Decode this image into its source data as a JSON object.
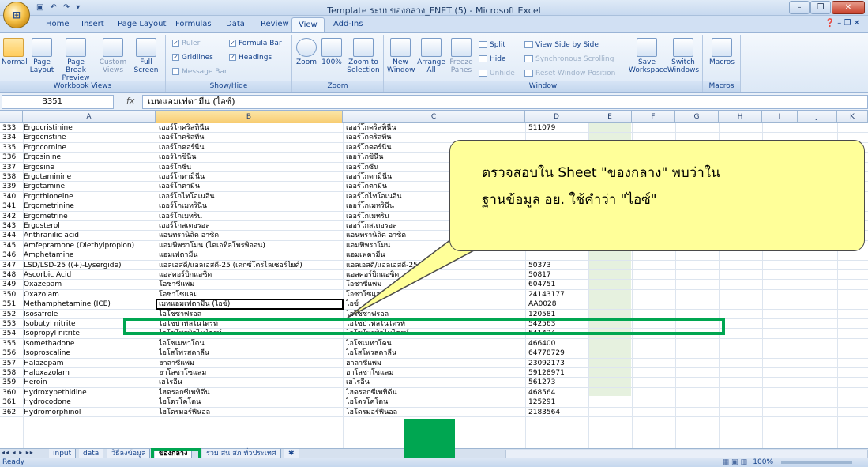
{
  "window": {
    "title": "Template ระบบของกลาง_FNET (5) - Microsoft Excel",
    "qat_icons": [
      "save-icon",
      "undo-icon",
      "redo-icon"
    ],
    "controls": [
      "minimize-icon",
      "restore-icon",
      "close-icon"
    ]
  },
  "ribbon_tabs": [
    "Home",
    "Insert",
    "Page Layout",
    "Formulas",
    "Data",
    "Review",
    "View",
    "Add-Ins"
  ],
  "active_tab": "View",
  "ribbon": {
    "workbook_views": {
      "label": "Workbook Views",
      "normal": "Normal",
      "page_layout": "Page Layout",
      "page_break_preview": "Page Break Preview",
      "custom_views": "Custom Views",
      "full_screen": "Full Screen"
    },
    "show_hide": {
      "label": "Show/Hide",
      "ruler": "Ruler",
      "formula_bar": "Formula Bar",
      "gridlines": "Gridlines",
      "headings": "Headings",
      "message_bar": "Message Bar"
    },
    "zoom": {
      "label": "Zoom",
      "zoom": "Zoom",
      "hundred": "100%",
      "zoom_to_selection": "Zoom to Selection"
    },
    "window": {
      "label": "Window",
      "new_window": "New Window",
      "arrange_all": "Arrange All",
      "freeze_panes": "Freeze Panes",
      "split": "Split",
      "hide": "Hide",
      "unhide": "Unhide",
      "view_side_by_side": "View Side by Side",
      "synchronous_scrolling": "Synchronous Scrolling",
      "reset_window_position": "Reset Window Position",
      "save_workspace": "Save Workspace",
      "switch_windows": "Switch Windows"
    },
    "macros": {
      "label": "Macros",
      "macros": "Macros"
    }
  },
  "formula_bar": {
    "name_box": "B351",
    "fx": "fx",
    "value": "เมทแอมเฟตามีน (ไอซ์)"
  },
  "columns": [
    "A",
    "B",
    "C",
    "D",
    "E",
    "F",
    "G",
    "H",
    "I",
    "J",
    "K"
  ],
  "rows": [
    {
      "n": "333",
      "a": "Ergocristinine",
      "b": "เออร์โกคริสทินีน",
      "c": "เออร์โกคริสทินีน",
      "d": "511079"
    },
    {
      "n": "334",
      "a": "Ergocristine",
      "b": "เออร์โกคริสทีน",
      "c": "เออร์โกคริสทีน",
      "d": ""
    },
    {
      "n": "335",
      "a": "Ergocornine",
      "b": "เออร์โกคอร์นีน",
      "c": "เออร์โกคอร์นีน",
      "d": ""
    },
    {
      "n": "336",
      "a": "Ergosinine",
      "b": "เออร์โกซินีน",
      "c": "เออร์โกซินีน",
      "d": ""
    },
    {
      "n": "337",
      "a": "Ergosine",
      "b": "เออร์โกซีน",
      "c": "เออร์โกซีน",
      "d": ""
    },
    {
      "n": "338",
      "a": "Ergotaminine",
      "b": "เออร์โกตามินีน",
      "c": "เออร์โกตามินีน",
      "d": ""
    },
    {
      "n": "339",
      "a": "Ergotamine",
      "b": "เออร์โกตามีน",
      "c": "เออร์โกตามีน",
      "d": ""
    },
    {
      "n": "340",
      "a": "Ergothioneine",
      "b": "เออร์โกไทโอเนอีน",
      "c": "เออร์โกไทโอเนอีน",
      "d": ""
    },
    {
      "n": "341",
      "a": "Ergometrinine",
      "b": "เออร์โกเมทรินีน",
      "c": "เออร์โกเมทรินีน",
      "d": ""
    },
    {
      "n": "342",
      "a": "Ergometrine",
      "b": "เออร์โกเมทริน",
      "c": "เออร์โกเมทริน",
      "d": ""
    },
    {
      "n": "343",
      "a": "Ergosterol",
      "b": "เออร์โกสเตอรอล",
      "c": "เออร์โกสเตอรอล",
      "d": ""
    },
    {
      "n": "344",
      "a": "Anthranilic acid",
      "b": "แอนทรานิลิค อาซิด",
      "c": "แอนทรานิลิค อาซิด",
      "d": ""
    },
    {
      "n": "345",
      "a": "Amfepramone (Diethylpropion)",
      "b": "แอมฟีพราโมน (ไดเอทิลโพรพิออน)",
      "c": "แอมฟีพราโมน",
      "d": ""
    },
    {
      "n": "346",
      "a": "Amphetamine",
      "b": "แอมเฟตามีน",
      "c": "แอมเฟตามีน",
      "d": ""
    },
    {
      "n": "347",
      "a": "LSD/LSD-25 ((+)-Lysergide)",
      "b": "แอลเอสดี/แอลเอสดี-25 (เดกซ์โตรไลเซอร์ไยด์)",
      "c": "แอลเอสดี/แอลเอสดี-25",
      "d": "50373"
    },
    {
      "n": "348",
      "a": "Ascorbic Acid",
      "b": "แอสคอร์บิกแอซิด",
      "c": "แอสคอร์บิกแอซิด",
      "d": "50817"
    },
    {
      "n": "349",
      "a": "Oxazepam",
      "b": "โอซาซีแพม",
      "c": "โอซาซีแพม",
      "d": "604751"
    },
    {
      "n": "350",
      "a": "Oxazolam",
      "b": "โอซาโซแลม",
      "c": "โอซาโซแลม",
      "d": "24143177"
    },
    {
      "n": "351",
      "a": "Methamphetamine (ICE)",
      "b": "เมทแอมเฟตามีน (ไอซ์)",
      "c": "ไอซ์",
      "d": "AA0028"
    },
    {
      "n": "352",
      "a": "Isosafrole",
      "b": "ไอโซซาฟรอล",
      "c": "ไอโซซาฟรอล",
      "d": "120581"
    },
    {
      "n": "353",
      "a": "Isobutyl nitrite",
      "b": "ไอโซบิวทิลไนไตรท์",
      "c": "ไอโซบิวทิลไนไตรท์",
      "d": "542563"
    },
    {
      "n": "354",
      "a": "Isopropyl nitrite",
      "b": "ไอโซโพรพิลไนไตรท์",
      "c": "ไอโซโพรพิลไนไตรท์",
      "d": "541424"
    },
    {
      "n": "355",
      "a": "Isomethadone",
      "b": "ไอโซเมทาโดน",
      "c": "ไอโซเมทาโดน",
      "d": "466400"
    },
    {
      "n": "356",
      "a": "Isoproscaline",
      "b": "ไอโสโพรสคาลีน",
      "c": "ไอโสโพรสคาลีน",
      "d": "64778729"
    },
    {
      "n": "357",
      "a": "Halazepam",
      "b": "ฮาลาซีแพม",
      "c": "ฮาลาซีแพม",
      "d": "23092173"
    },
    {
      "n": "358",
      "a": "Haloxazolam",
      "b": "ฮาโลซาโซแลม",
      "c": "ฮาโลซาโซแลม",
      "d": "59128971"
    },
    {
      "n": "359",
      "a": "Heroin",
      "b": "เฮโรอีน",
      "c": "เฮโรอีน",
      "d": "561273"
    },
    {
      "n": "360",
      "a": "Hydroxypethidine",
      "b": "ไฮดรอกซีเพทิดีน",
      "c": "ไฮดรอกซีเพทิดีน",
      "d": "468564"
    },
    {
      "n": "361",
      "a": "Hydrocodone",
      "b": "ไฮโดรโคโดน",
      "c": "ไฮโดรโคโดน",
      "d": "125291"
    },
    {
      "n": "362",
      "a": "Hydromorphinol",
      "b": "ไฮโดรมอร์ฟีนอล",
      "c": "ไฮโดรมอร์ฟีนอล",
      "d": "2183564"
    }
  ],
  "callout": {
    "line1": "ตรวจสอบใน Sheet \"ของกลาง\" พบว่าใน",
    "line2": "ฐานข้อมูล อย. ใช้คำว่า \"ไอซ์\""
  },
  "sheet_tabs": [
    "input",
    "data",
    "วิธีลงข้อมูล",
    "ของกลาง",
    "รวม สน สภ ทั่วประเทศ"
  ],
  "active_sheet": "ของกลาง",
  "status": {
    "ready": "Ready",
    "zoom": "100%"
  },
  "colors": {
    "highlight": "#00a651",
    "callout_fill": "#ffff99"
  }
}
